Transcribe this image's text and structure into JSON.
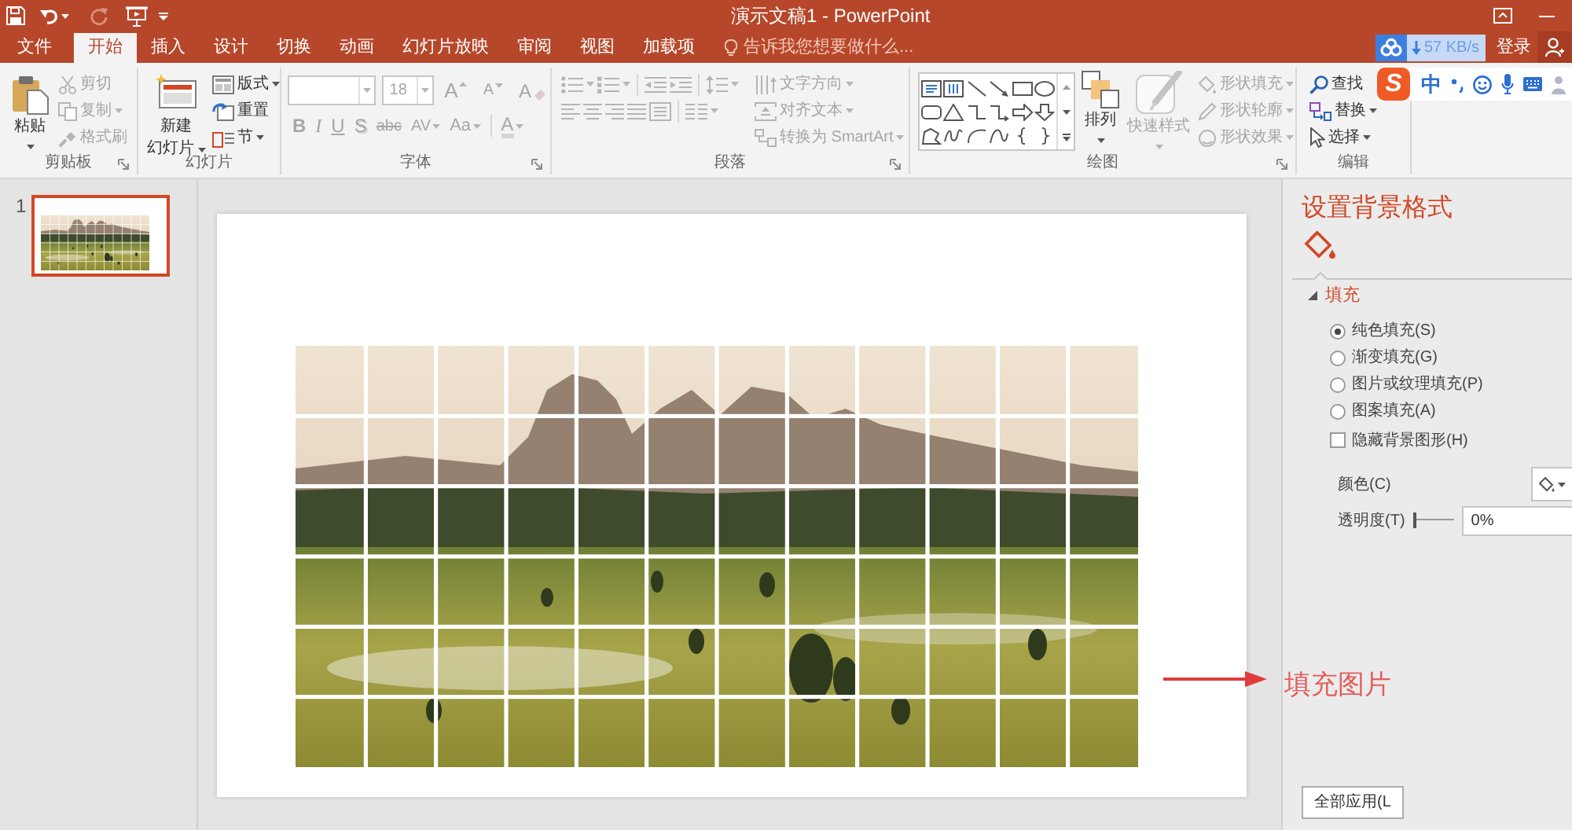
{
  "window": {
    "title": "演示文稿1 - PowerPoint"
  },
  "quick_access": [
    {
      "kind": "save",
      "disabled": false
    },
    {
      "kind": "undo",
      "disabled": false,
      "dropdown": true
    },
    {
      "kind": "redo",
      "disabled": true
    },
    {
      "kind": "slideshow",
      "disabled": false
    },
    {
      "kind": "customize",
      "disabled": false
    }
  ],
  "tabs": [
    {
      "label": "文件",
      "selected": false
    },
    {
      "label": "开始",
      "selected": true
    },
    {
      "label": "插入",
      "selected": false
    },
    {
      "label": "设计",
      "selected": false
    },
    {
      "label": "切换",
      "selected": false
    },
    {
      "label": "动画",
      "selected": false
    },
    {
      "label": "幻灯片放映",
      "selected": false
    },
    {
      "label": "审阅",
      "selected": false
    },
    {
      "label": "视图",
      "selected": false
    },
    {
      "label": "加载项",
      "selected": false
    }
  ],
  "tell_me": {
    "placeholder": "告诉我您想要做什么..."
  },
  "download_badge": {
    "speed": "57 KB/s"
  },
  "account": {
    "sign_in": "登录"
  },
  "ime_toolbar": {
    "logo": "S",
    "mode": "中"
  },
  "ribbon": [
    {
      "label": "剪贴板",
      "items": [
        {
          "kind": "large",
          "label": "粘贴",
          "dropdown": true,
          "disabled": false
        },
        {
          "kind": "small",
          "label": "剪切",
          "disabled": true
        },
        {
          "kind": "small",
          "label": "复制",
          "dropdown": true,
          "disabled": true
        },
        {
          "kind": "small",
          "label": "格式刷",
          "disabled": true
        }
      ]
    },
    {
      "label": "幻灯片",
      "items": [
        {
          "kind": "large",
          "lines": [
            "新建",
            "幻灯片"
          ],
          "dropdown": true,
          "disabled": false
        },
        {
          "kind": "small",
          "label": "版式",
          "dropdown": true,
          "disabled": false
        },
        {
          "kind": "small",
          "label": "重置",
          "disabled": false
        },
        {
          "kind": "small",
          "label": "节",
          "dropdown": true,
          "disabled": false
        }
      ]
    },
    {
      "label": "字体",
      "top_row": [
        {
          "kind": "field",
          "dropdown": true,
          "disabled": true
        },
        {
          "kind": "field",
          "value": "18",
          "dropdown": true,
          "disabled": true
        },
        {
          "kind": "glyph",
          "text": "A",
          "disabled": true
        },
        {
          "kind": "glyph",
          "text": "A",
          "disabled": true
        },
        {
          "kind": "glyph",
          "text": "A",
          "disabled": true
        }
      ],
      "bottom_row": [
        {
          "kind": "glyph",
          "text": "B",
          "disabled": true
        },
        {
          "kind": "glyph",
          "text": "I",
          "disabled": true
        },
        {
          "kind": "glyph",
          "text": "U",
          "disabled": true
        },
        {
          "kind": "glyph",
          "text": "S",
          "disabled": true
        },
        {
          "kind": "glyph",
          "text": "abc",
          "disabled": true
        },
        {
          "kind": "glyph",
          "text": "AV",
          "dropdown": true,
          "disabled": true
        },
        {
          "kind": "glyph",
          "text": "Aa",
          "dropdown": true,
          "disabled": true
        },
        {
          "kind": "glyph",
          "text": "A",
          "dropdown": true,
          "disabled": true
        }
      ]
    },
    {
      "label": "段落",
      "items": [
        {
          "kind": "icon",
          "dropdown": true,
          "disabled": true
        },
        {
          "kind": "icon",
          "dropdown": true,
          "disabled": true
        },
        {
          "kind": "icon",
          "disabled": true
        },
        {
          "kind": "icon",
          "disabled": true
        },
        {
          "kind": "icon",
          "dropdown": true,
          "disabled": true
        },
        {
          "kind": "small",
          "label": "文字方向",
          "dropdown": true,
          "disabled": true
        },
        {
          "kind": "icon",
          "disabled": true
        },
        {
          "kind": "icon",
          "disabled": true
        },
        {
          "kind": "icon",
          "disabled": true
        },
        {
          "kind": "icon",
          "disabled": true
        },
        {
          "kind": "icon",
          "disabled": true
        },
        {
          "kind": "icon",
          "dropdown": true,
          "disabled": true
        },
        {
          "kind": "small",
          "label": "对齐文本",
          "dropdown": true,
          "disabled": true
        },
        {
          "kind": "small",
          "label": "转换为 SmartArt",
          "dropdown": true,
          "disabled": true
        }
      ]
    },
    {
      "label": "绘图",
      "items": [
        {
          "kind": "large",
          "label": "排列",
          "dropdown": true,
          "disabled": false
        },
        {
          "kind": "large",
          "label": "快速样式",
          "dropdown": true,
          "disabled": true
        },
        {
          "kind": "small",
          "label": "形状填充",
          "dropdown": true,
          "disabled": true
        },
        {
          "kind": "small",
          "label": "形状轮廓",
          "dropdown": true,
          "disabled": true
        },
        {
          "kind": "small",
          "label": "形状效果",
          "dropdown": true,
          "disabled": true
        }
      ]
    },
    {
      "label": "编辑",
      "items": [
        {
          "kind": "small",
          "label": "查找",
          "disabled": false
        },
        {
          "kind": "small",
          "label": "替换",
          "dropdown": true,
          "disabled": false
        },
        {
          "kind": "small",
          "label": "选择",
          "dropdown": true,
          "disabled": false
        }
      ]
    }
  ],
  "slides": [
    {
      "number": "1",
      "selected": true
    }
  ],
  "format_pane": {
    "title": "设置背景格式",
    "section": {
      "label": "填充",
      "expanded": true
    },
    "fill_options": [
      {
        "label": "纯色填充(S)",
        "selected": true
      },
      {
        "label": "渐变填充(G)",
        "selected": false
      },
      {
        "label": "图片或纹理填充(P)",
        "selected": false
      },
      {
        "label": "图案填充(A)",
        "selected": false
      }
    ],
    "hide_background": {
      "label": "隐藏背景图形(H)",
      "checked": false
    },
    "color": {
      "label": "颜色(C)"
    },
    "transparency": {
      "label": "透明度(T)",
      "level": 0,
      "value": "0%"
    },
    "apply_all": {
      "label": "全部应用(L"
    }
  },
  "annotation": {
    "text": "填充图片"
  }
}
